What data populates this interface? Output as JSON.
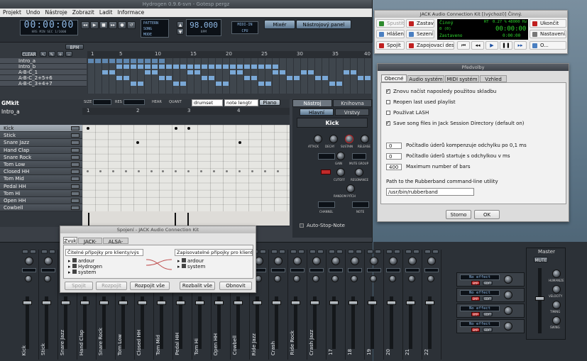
{
  "hydrogen": {
    "title": "Hydrogen 0.9.6-svn - Gotesp pergz",
    "menu": [
      "Projekt",
      "Undo",
      "Nástroje",
      "Zobrazit",
      "Ladit",
      "Informace"
    ],
    "time_display": "00:00:00",
    "time_sub": "HRS  MIN  SEC  1/1000",
    "bpm": "98.000",
    "bpm_label": "BPM",
    "cpu_label": "CPU",
    "midi_in": "MIDI-IN",
    "mixer_button": "Mixér",
    "toolpanel_button": "Nástrojový panel",
    "pattern_mode": [
      "PATTERN",
      "SONG",
      "MODE"
    ],
    "song_controls": {
      "bpm_btn": "BPM",
      "clear": "CLEAR"
    },
    "song_patterns": [
      "Intro_a",
      "Intro_b",
      "A-B-C_1",
      "A-B-C_2+5+6",
      "A-B-C_3+4+7"
    ],
    "song_ruler": [
      "1",
      "5",
      "10",
      "15",
      "20",
      "25",
      "30",
      "35",
      "40"
    ],
    "pattern_editor": {
      "kit_label": "GMkit",
      "pattern_name": "Intro_a",
      "size_label": "SIZE",
      "res_label": "RES",
      "hear_label": "HEAR",
      "quant_label": "QUANT",
      "drumset": "drumset",
      "note_length": "note lengtr",
      "piano": "Piano",
      "ruler": [
        "1",
        "2",
        "3",
        "4"
      ]
    },
    "instruments": [
      "Kick",
      "Stick",
      "Snare Jazz",
      "Hand Clap",
      "Snare Rock",
      "Tom Low",
      "Closed HH",
      "Tom Mid",
      "Pedal HH",
      "Tom Hi",
      "Open HH",
      "Cowbell"
    ],
    "selected_instrument": "Kick",
    "rack": {
      "tab_tool": "Nástroj",
      "tab_library": "Knihovna",
      "sub_main": "Hlavní",
      "sub_layers": "Vrstvy",
      "name": "Kick",
      "labels": [
        "ATTACK",
        "DECAY",
        "SUSTAIN",
        "RELEASE",
        "GAIN",
        "MUTE GROUP",
        "CUTOFF",
        "RESONANCE",
        "RANDOM PITCH",
        "CHANNEL",
        "NOTE"
      ],
      "auto_stop": "Auto-Stop-Note"
    },
    "mixer_channels": [
      "Kick",
      "Stick",
      "Snare Jazz",
      "Hand Clap",
      "Snare Rock",
      "Tom Low",
      "Closed HH",
      "Tom Mid",
      "Pedal HH",
      "Tom Hi",
      "Open HH",
      "Cowbell",
      "Ride Jazz",
      "Crash",
      "Ride Rock",
      "Crash Jazz",
      "17",
      "18",
      "19",
      "20",
      "21",
      "22"
    ],
    "master_label": "Master",
    "master_mute": "MUTE",
    "fx_label": "No effect",
    "fx_bypass": "BYP",
    "fx_edit": "EDIT",
    "fx_return": "Return",
    "master_knobs": [
      "HUMANIZE",
      "VELOCITY",
      "TIMING",
      "SWING"
    ]
  },
  "jack": {
    "title": "JACK Audio Connection Kit [(výchozí)] Činný.",
    "buttons": {
      "start": "Spustit",
      "stop": "Zastavit",
      "quit": "Ukončit",
      "messages": "Hlášení",
      "session": "Sezení",
      "settings": "Nastavení...",
      "connect": "Spojit",
      "patchbay": "Zapojovací deska",
      "about": "O..."
    },
    "status": "Činný",
    "rt": "RT",
    "load": "0.27 %",
    "rate": "48000 Hz",
    "time": "00:00:00",
    "stopped": "Zastaveno",
    "xruns": "0 (0)",
    "frame": "0:00:00",
    "colors": {
      "start_icon": "#2e8b2e",
      "stop_icon": "#c02020",
      "quit_icon": "#c02020"
    }
  },
  "prefs": {
    "title": "Předvolby",
    "tabs": [
      "Obecné",
      "Audio systém",
      "MIDI systém",
      "Vzhled"
    ],
    "options": [
      {
        "label": "Znovu načíst naposledy použitou skladbu",
        "checked": true
      },
      {
        "label": "Reopen last used playlist",
        "checked": false
      },
      {
        "label": "Používat LASH",
        "checked": false
      },
      {
        "label": "Save song files in Jack Session Directory (default on)",
        "checked": true
      }
    ],
    "spin1": {
      "value": "0",
      "label": "Počítadlo úderů kompenzuje odchylku po 0,1 ms"
    },
    "spin2": {
      "value": "0",
      "label": "Počítadlo úderů startuje s odchylkou v ms"
    },
    "spin3": {
      "value": "400",
      "label": "Maximum number of bars"
    },
    "rubberband_label": "Path to the Rubberband command-line utility",
    "rubberband_path": "/usr/bin/rubberband",
    "cancel": "Storno",
    "ok": "OK"
  },
  "connections": {
    "title": "Spojení - JACK Audio Connection Kit",
    "tabs": [
      "Zvuk",
      "JACK-MIDI",
      "ALSA-MIDI"
    ],
    "readable": "Čitelné přípojky pro klienty/výs",
    "writable": "Zapisovatelné přípojky pro klienty",
    "left_items": [
      "ardour",
      "Hydrogen",
      "system"
    ],
    "right_items": [
      "ardour",
      "system"
    ],
    "buttons": {
      "connect": "Spojit",
      "disconnect": "Rozpojit",
      "disconnect_all": "Rozpojit vše",
      "expand_all": "Rozbalit vše",
      "refresh": "Obnovit"
    }
  }
}
